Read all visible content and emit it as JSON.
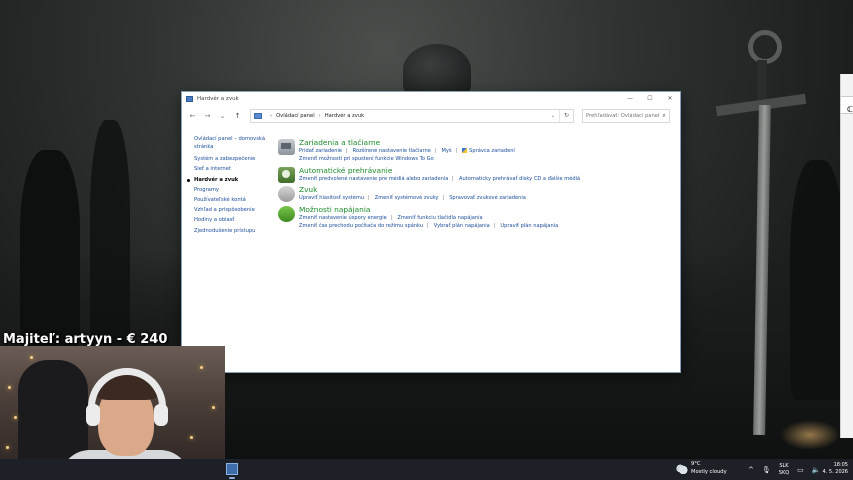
{
  "desktop": {
    "stream_owner_label": "Majiteľ: artyyn - € 240"
  },
  "window": {
    "title": "Hardvér a zvuk",
    "controls": {
      "minimize": "—",
      "maximize": "☐",
      "close": "✕"
    },
    "nav": {
      "back": "←",
      "forward": "→",
      "recent": "⌄",
      "up": "↑"
    },
    "breadcrumb": [
      "Ovládací panel",
      "Hardvér a zvuk"
    ],
    "address_dropdown": "⌄",
    "refresh": "↻",
    "search": {
      "placeholder": "Prehľadávať: Ovládací panel",
      "icon": "search-icon"
    },
    "left_nav": [
      {
        "label": "Ovládací panel – domovská stránka",
        "current": false
      },
      {
        "label": "Systém a zabezpečenie",
        "current": false
      },
      {
        "label": "Sieť a internet",
        "current": false
      },
      {
        "label": "Hardvér a zvuk",
        "current": true
      },
      {
        "label": "Programy",
        "current": false
      },
      {
        "label": "Používateľské kontá",
        "current": false
      },
      {
        "label": "Vzhľad a prispôsobenie",
        "current": false
      },
      {
        "label": "Hodiny a oblasť",
        "current": false
      },
      {
        "label": "Zjednodušenie prístupu",
        "current": false
      }
    ],
    "sections": [
      {
        "title": "Zariadenia a tlačiarne",
        "icon": "printer-icon",
        "rows": [
          [
            "Pridať zariadenie",
            "Rozšírené nastavenie tlačiarne",
            "Myš",
            "Správca zariadení"
          ],
          [
            "Zmeniť možnosti pri spustení funkcie Windows To Go"
          ]
        ]
      },
      {
        "title": "Automatické prehrávanie",
        "icon": "autoplay-icon",
        "rows": [
          [
            "Zmeniť predvolené nastavenie pre médiá alebo zariadenia",
            "Automaticky prehrávať disky CD a ďalšie médiá"
          ]
        ]
      },
      {
        "title": "Zvuk",
        "icon": "speaker-icon",
        "rows": [
          [
            "Upraviť hlasitosť systému",
            "Zmeniť systémové zvuky",
            "Spravovať zvukové zariadenia"
          ]
        ]
      },
      {
        "title": "Možnosti napájania",
        "icon": "power-icon",
        "rows": [
          [
            "Zmeniť nastavenie úspory energie",
            "Zmeniť funkciu tlačidla napájania"
          ],
          [
            "Zmeniť čas prechodu počítača do režimu spánku",
            "Vybrať plán napájania",
            "Upraviť plán napájania"
          ]
        ]
      }
    ]
  },
  "taskbar": {
    "weather_temp": "9°C",
    "weather_desc": "Mostly cloudy",
    "lang_line1": "SLK",
    "lang_line2": "SKQ",
    "time": "18:05",
    "date": "4. 5. 2026",
    "tray_chevron": "^"
  }
}
